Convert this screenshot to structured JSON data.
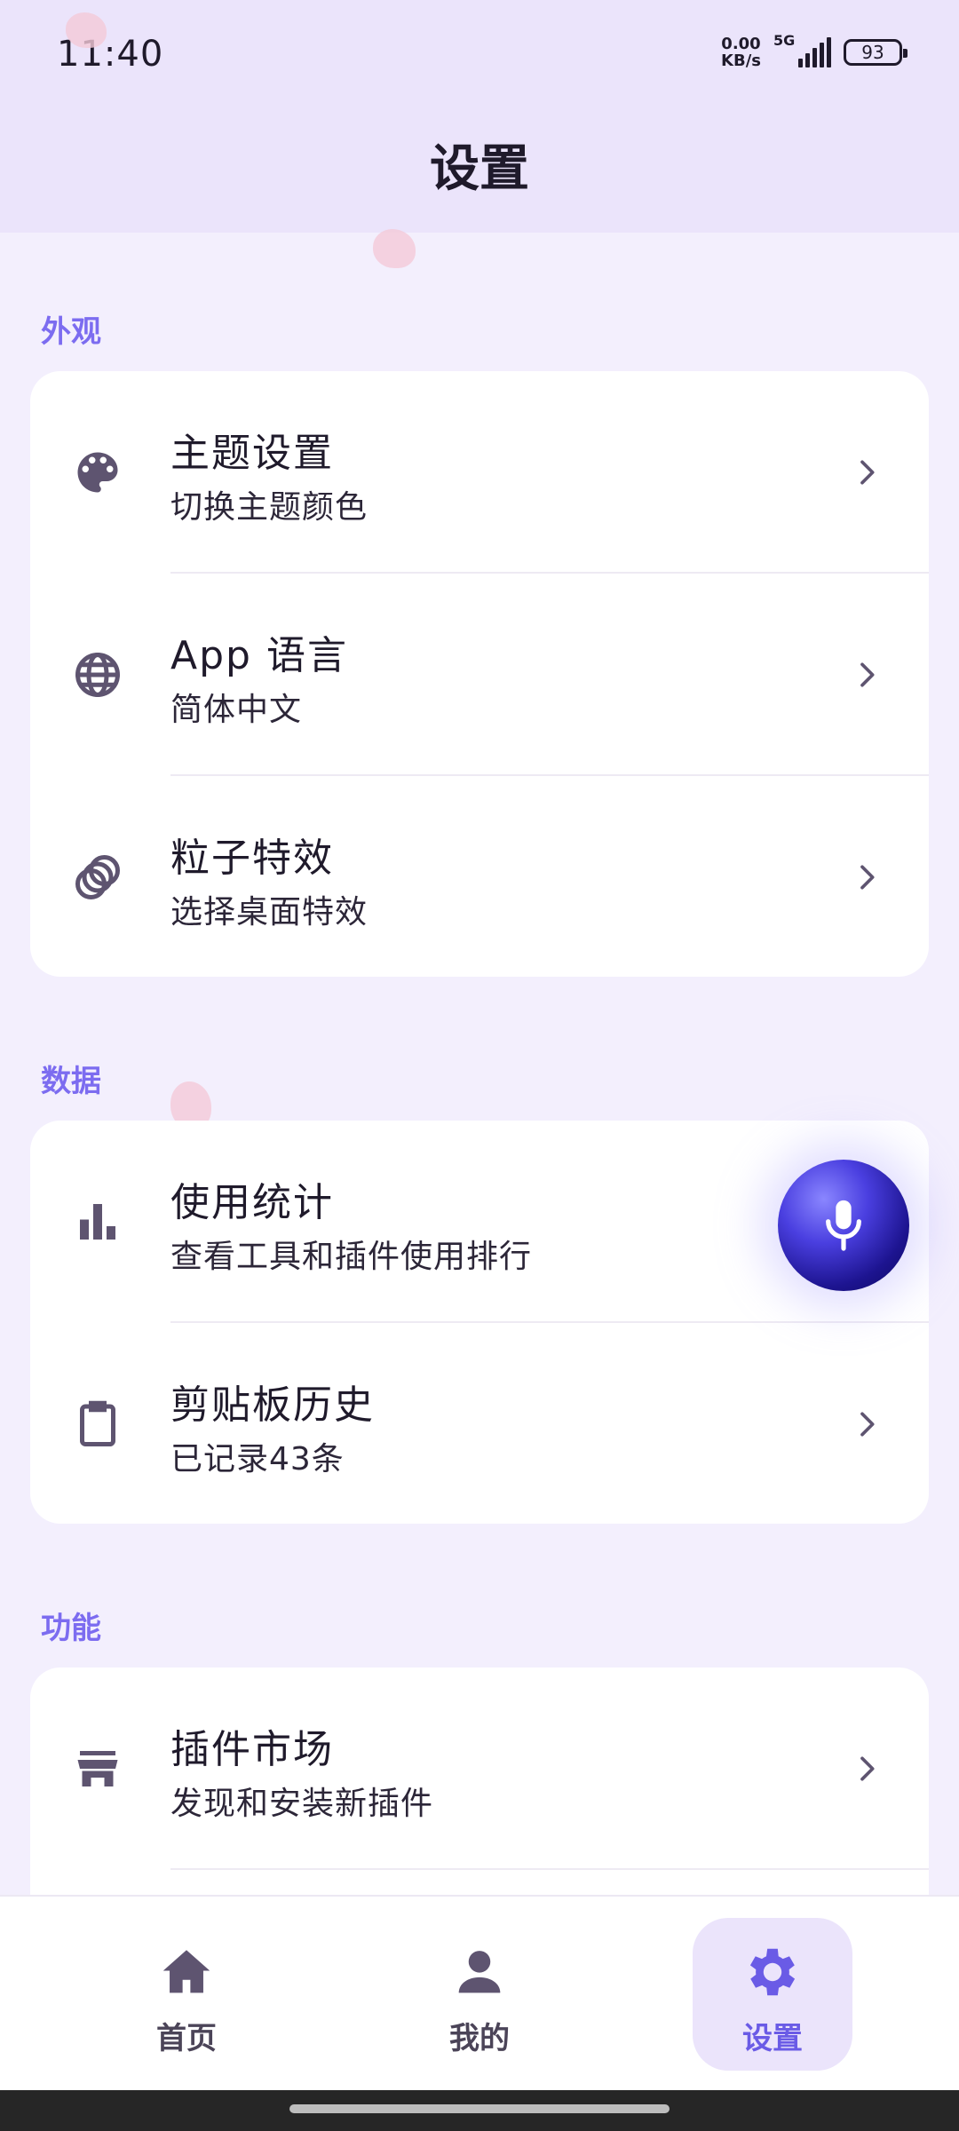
{
  "status_bar": {
    "time": "11:40",
    "net_speed_value": "0.00",
    "net_speed_unit": "KB/s",
    "network": "5G",
    "battery": "93"
  },
  "page_title": "设置",
  "sections": {
    "appearance": {
      "label": "外观",
      "items": [
        {
          "title": "主题设置",
          "subtitle": "切换主题颜色",
          "icon": "palette-icon"
        },
        {
          "title": "App 语言",
          "subtitle": "简体中文",
          "icon": "globe-icon"
        },
        {
          "title": "粒子特效",
          "subtitle": "选择桌面特效",
          "icon": "particles-icon"
        }
      ]
    },
    "data": {
      "label": "数据",
      "items": [
        {
          "title": "使用统计",
          "subtitle": "查看工具和插件使用排行",
          "icon": "bar-chart-icon"
        },
        {
          "title": "剪贴板历史",
          "subtitle": "已记录43条",
          "icon": "clipboard-icon"
        }
      ]
    },
    "features": {
      "label": "功能",
      "items": [
        {
          "title": "插件市场",
          "subtitle": "发现和安装新插件",
          "icon": "store-icon"
        }
      ]
    }
  },
  "bottom_nav": {
    "home": "首页",
    "mine": "我的",
    "settings": "设置",
    "active": "settings"
  },
  "colors": {
    "accent": "#7c6cf0",
    "header_bg": "#ebe4fb",
    "page_bg": "#f3effd"
  }
}
